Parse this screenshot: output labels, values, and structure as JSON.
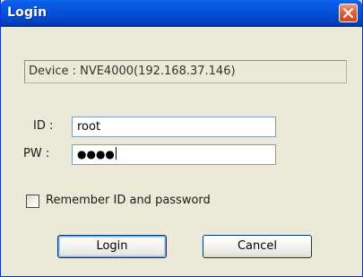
{
  "window": {
    "title": "Login"
  },
  "device": {
    "text": "Device : NVE4000(192.168.37.146)"
  },
  "form": {
    "id_label": "ID :",
    "id_value": "root",
    "pw_label": "PW :",
    "pw_value": "●●●●"
  },
  "remember": {
    "label": "Remember ID and password",
    "checked": false
  },
  "buttons": {
    "login": "Login",
    "cancel": "Cancel"
  },
  "icons": {
    "close": "close-icon"
  },
  "colors": {
    "titlebar": "#0653db",
    "close_button": "#e0613c",
    "window_bg": "#ece9d8",
    "input_border": "#7f9db9",
    "button_border": "#003c74"
  }
}
